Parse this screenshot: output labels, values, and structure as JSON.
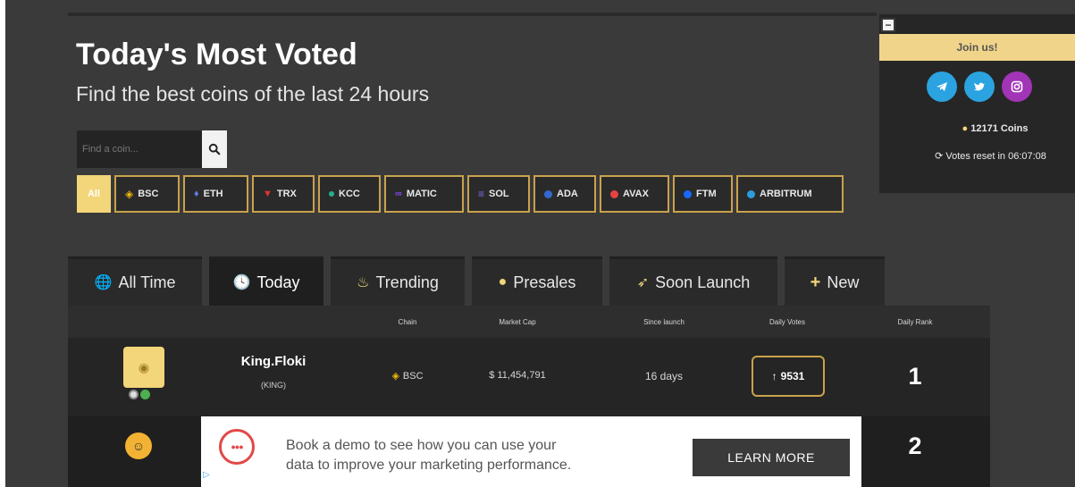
{
  "header": {
    "title": "Today's Most Voted",
    "subtitle": "Find the best coins of the last 24 hours"
  },
  "search": {
    "placeholder": "Find a coin..."
  },
  "chains": [
    {
      "label": "All",
      "color": "#f3d67a"
    },
    {
      "label": "BSC",
      "color": "#f0b90b"
    },
    {
      "label": "ETH",
      "color": "#627eea"
    },
    {
      "label": "TRX",
      "color": "#e5322c"
    },
    {
      "label": "KCC",
      "color": "#23af91"
    },
    {
      "label": "MATIC",
      "color": "#8247e5"
    },
    {
      "label": "SOL",
      "color": "#7b6ee8"
    },
    {
      "label": "ADA",
      "color": "#3468d1"
    },
    {
      "label": "AVAX",
      "color": "#e84142"
    },
    {
      "label": "FTM",
      "color": "#1969ff"
    },
    {
      "label": "ARBITRUM",
      "color": "#2d9cdb"
    }
  ],
  "tabs": [
    {
      "label": "All Time",
      "icon": "globe-icon"
    },
    {
      "label": "Today",
      "icon": "clock-icon"
    },
    {
      "label": "Trending",
      "icon": "fire-icon"
    },
    {
      "label": "Presales",
      "icon": "money-bag-icon"
    },
    {
      "label": "Soon Launch",
      "icon": "rocket-icon"
    },
    {
      "label": "New",
      "icon": "plus-icon"
    }
  ],
  "table": {
    "headers": [
      "Chain",
      "Market Cap",
      "Since launch",
      "Daily Votes",
      "Daily Rank"
    ],
    "rows": [
      {
        "name": "King.Floki",
        "symbol": "(KING)",
        "chain": "BSC",
        "market_cap": "$ 11,454,791",
        "since_launch": "16 days",
        "votes": "9531",
        "rank": "1"
      },
      {
        "rank": "2"
      }
    ]
  },
  "sidebar": {
    "join_label": "Join us!",
    "coins_count": "12171 Coins",
    "votes_reset": "Votes reset in 06:07:08",
    "socials": [
      {
        "name": "telegram",
        "color": "#2aa3e0"
      },
      {
        "name": "twitter",
        "color": "#2aa3e0"
      },
      {
        "name": "instagram",
        "color": "#a234b6"
      }
    ]
  },
  "ad": {
    "text_line1": "Book a demo to see how you can use your",
    "text_line2": "data to improve your marketing performance.",
    "button": "LEARN MORE",
    "logo_text": "●●●"
  }
}
